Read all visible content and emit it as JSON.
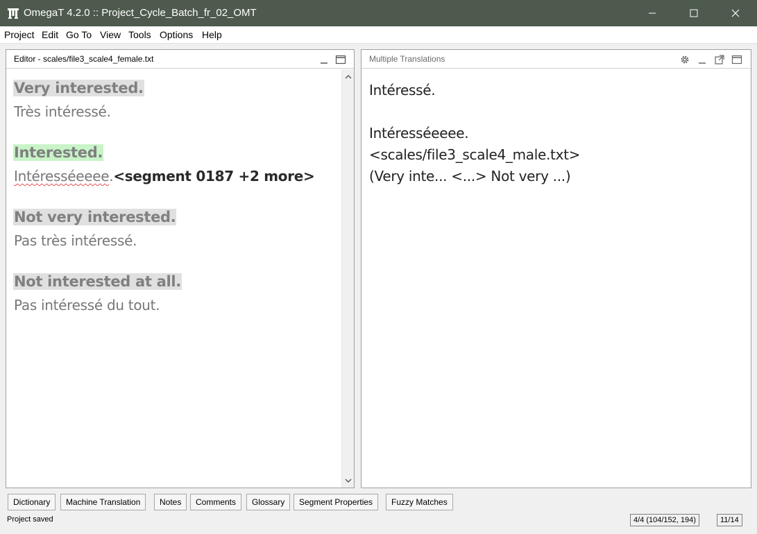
{
  "window": {
    "title": "OmegaT 4.2.0 :: Project_Cycle_Batch_fr_02_OMT",
    "titlebar_color": "#4d5a4d"
  },
  "menu": [
    "Project",
    "Edit",
    "Go To",
    "View",
    "Tools",
    "Options",
    "Help"
  ],
  "editor": {
    "title": "Editor - scales/file3_scale4_female.txt",
    "segments": [
      {
        "source": "Very interested.",
        "target": "Très intéressé."
      },
      {
        "source": "Interested.",
        "target_word": "Intéresséeeee",
        "target_punct": ".",
        "marker": "<segment 0187 +2 more>",
        "active": true
      },
      {
        "source": "Not very interested.",
        "target": "Pas très intéressé."
      },
      {
        "source": "Not interested at all.",
        "target": "Pas intéressé du tout."
      }
    ]
  },
  "multiple_translations": {
    "title": "Multiple Translations",
    "lines": [
      "Intéressé.",
      "Intéresséeeee.",
      "<scales/file3_scale4_male.txt>",
      "(Very inte... <...> Not very ...)"
    ]
  },
  "tabs": [
    "Dictionary",
    "Machine Translation",
    "Notes",
    "Comments",
    "Glossary",
    "Segment Properties",
    "Fuzzy Matches"
  ],
  "status": {
    "message": "Project saved",
    "progress": "4/4 (104/152, 194)",
    "segment_counter": "11/14"
  },
  "colors": {
    "active_segment": "#c8f4c8",
    "inactive_segment": "#e0e0e0"
  }
}
